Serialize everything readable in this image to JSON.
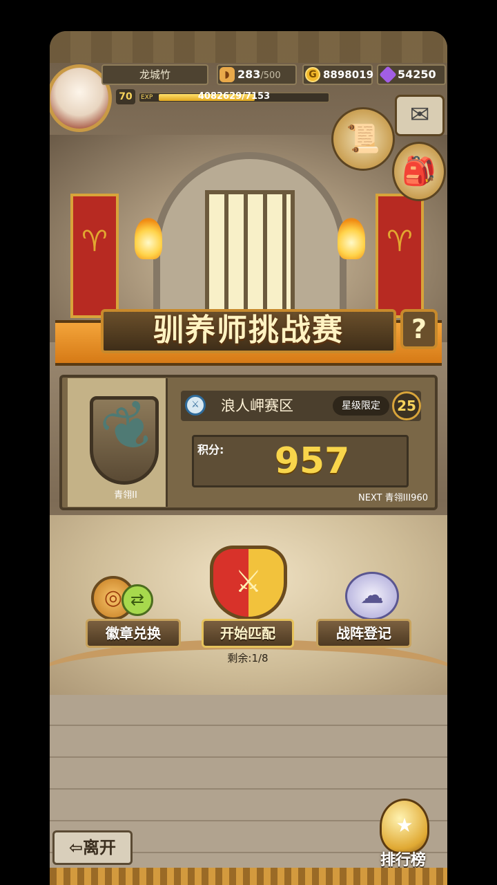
{
  "player": {
    "name": "龙城竹",
    "level": "70",
    "exp_label": "EXP",
    "exp_text": "4082629/7153",
    "exp_progress": 0.57
  },
  "resources": {
    "stamina": "283",
    "stamina_max": "/500",
    "gold": "8898019",
    "gem": "54250"
  },
  "icons": {
    "stamina": "bread-icon",
    "gold": "gold-coin-icon",
    "gem": "purple-gem-icon",
    "quest": "scroll-icon",
    "mail": "envelope-icon",
    "bag": "backpack-icon",
    "help": "question-icon"
  },
  "title": "驯养师挑战赛",
  "help_label": "?",
  "rank": {
    "badge_name": "青翎II",
    "zone_icon_text": "⚔",
    "zone": "浪人岬赛区",
    "limit_label": "星级限定",
    "limit_value": "25",
    "score_label": "积分:",
    "score": "957",
    "next": "NEXT 青翎III960"
  },
  "actions": {
    "badge_exchange": "徽章兑换",
    "start_match": "开始匹配",
    "lineup": "战阵登记",
    "remaining": "剩余:1/8"
  },
  "bottom": {
    "leave": "⇦离开",
    "leaderboard": "排行榜"
  },
  "colors": {
    "accent_orange": "#d67a16",
    "score_yellow": "#f8d54b",
    "banner_red": "#b72a22"
  }
}
